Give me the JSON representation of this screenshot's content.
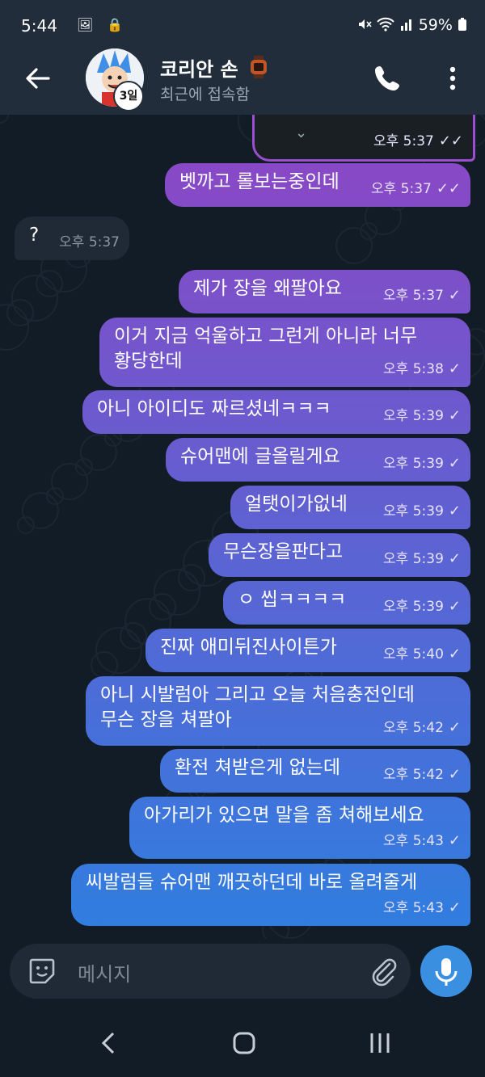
{
  "status_bar": {
    "time": "5:44",
    "left_icons": "🖼 🔒",
    "battery": "59%"
  },
  "header": {
    "contact_name": "코리안 손",
    "status": "최근에 접속함",
    "story_badge": "3일"
  },
  "messages": [
    {
      "text": "",
      "time": "오후 5:37",
      "check": "✓✓",
      "out": true
    },
    {
      "text": "벳까고 롤보는중인데",
      "time": "오후 5:37",
      "check": "✓✓",
      "out": true
    },
    {
      "text": "?",
      "time": "오후 5:37",
      "check": "",
      "out": false
    },
    {
      "text": "제가 장을 왜팔아요",
      "time": "오후 5:37",
      "check": "✓",
      "out": true
    },
    {
      "text": "이거 지금 억울하고 그런게 아니라 너무\n황당한데",
      "time": "오후 5:38",
      "check": "✓",
      "out": true
    },
    {
      "text": "아니 아이디도 짜르셨네ㅋㅋㅋ",
      "time": "오후 5:39",
      "check": "✓",
      "out": true
    },
    {
      "text": "슈어맨에 글올릴게요",
      "time": "오후 5:39",
      "check": "✓",
      "out": true
    },
    {
      "text": "얼탯이가없네",
      "time": "오후 5:39",
      "check": "✓",
      "out": true
    },
    {
      "text": "무슨장을판다고",
      "time": "오후 5:39",
      "check": "✓",
      "out": true
    },
    {
      "text": "ㅇ 씹ㅋㅋㅋㅋ",
      "time": "오후 5:39",
      "check": "✓",
      "out": true
    },
    {
      "text": "진짜 애미뒤진사이튼가",
      "time": "오후 5:40",
      "check": "✓",
      "out": true
    },
    {
      "text": "아니 시발럼아 그리고 오늘 처음충전인데\n무슨 장을 쳐팔아",
      "time": "오후 5:42",
      "check": "✓",
      "out": true
    },
    {
      "text": "환전 쳐받은게 없는데",
      "time": "오후 5:42",
      "check": "✓",
      "out": true
    },
    {
      "text": "아가리가 있으면 말을 좀 쳐해보세요",
      "time": "오후 5:43",
      "check": "✓",
      "out": true
    },
    {
      "text": "씨발럼들 슈어맨 깨끗하던데 바로 올려줄게",
      "time": "오후 5:43",
      "check": "✓",
      "out": true
    }
  ],
  "composer": {
    "placeholder": "메시지"
  },
  "icons": {
    "back": "arrow-left-icon",
    "phone": "phone-icon",
    "menu": "more-vertical-icon",
    "sticker": "sticker-icon",
    "attach": "paperclip-icon",
    "mic": "microphone-icon"
  },
  "colors": {
    "header_bg": "#212d3b",
    "chat_bg": "#121c26",
    "incoming_bubble": "#1f2a36",
    "outgoing_gradient_top": "#8f45c4",
    "outgoing_gradient_bottom": "#2f7ee0",
    "accent": "#3a8fe0"
  }
}
